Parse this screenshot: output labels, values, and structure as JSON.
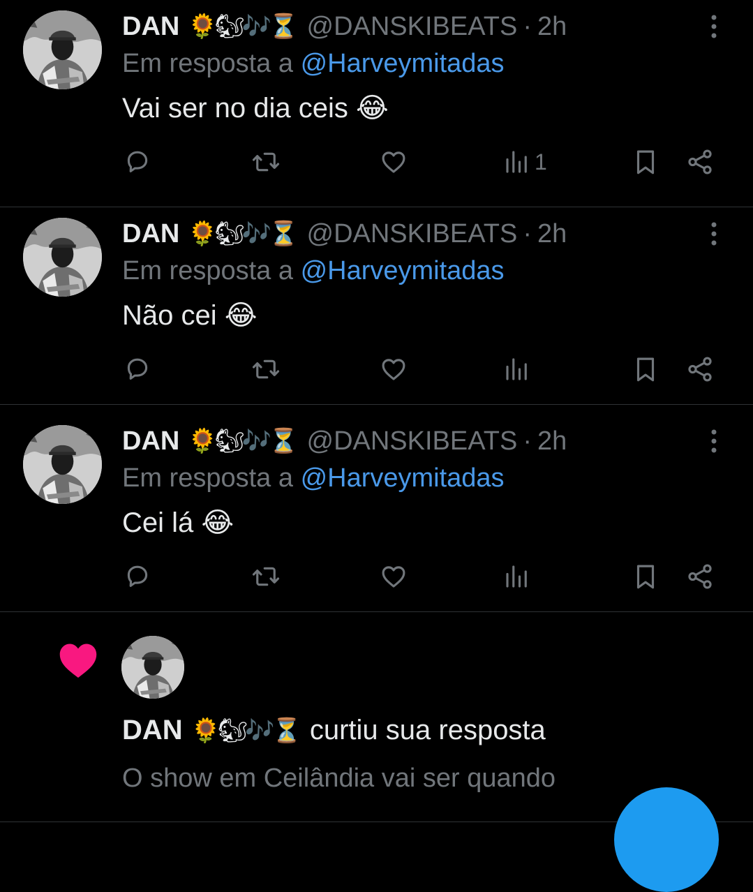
{
  "colors": {
    "background": "#000000",
    "text": "#e7e9ea",
    "secondary": "#71767b",
    "mention": "#4a99e9",
    "divider": "#2f3336",
    "like_heart": "#f91880",
    "fab": "#1d9bf0"
  },
  "tweets": [
    {
      "display_name": "DAN",
      "name_emojis": "🌻🐿🎶⏳",
      "handle": "@DANSKIBEATS",
      "separator": "·",
      "time": "2h",
      "reply_prefix": "Em resposta a",
      "reply_to": "@Harveymitadas",
      "text": "Vai ser no dia ceis 😂",
      "views": "1",
      "icons": [
        "reply-icon",
        "retweet-icon",
        "like-icon",
        "views-icon",
        "bookmark-icon",
        "share-icon",
        "more-icon"
      ]
    },
    {
      "display_name": "DAN",
      "name_emojis": "🌻🐿🎶⏳",
      "handle": "@DANSKIBEATS",
      "separator": "·",
      "time": "2h",
      "reply_prefix": "Em resposta a",
      "reply_to": "@Harveymitadas",
      "text": "Não cei 😂",
      "views": "",
      "icons": [
        "reply-icon",
        "retweet-icon",
        "like-icon",
        "views-icon",
        "bookmark-icon",
        "share-icon",
        "more-icon"
      ]
    },
    {
      "display_name": "DAN",
      "name_emojis": "🌻🐿🎶⏳",
      "handle": "@DANSKIBEATS",
      "separator": "·",
      "time": "2h",
      "reply_prefix": "Em resposta a",
      "reply_to": "@Harveymitadas",
      "text": "Cei lá 😂",
      "views": "",
      "icons": [
        "reply-icon",
        "retweet-icon",
        "like-icon",
        "views-icon",
        "bookmark-icon",
        "share-icon",
        "more-icon"
      ]
    }
  ],
  "notification": {
    "icon": "heart-icon",
    "display_name": "DAN",
    "name_emojis": "🌻🐿🎶⏳",
    "action": "curtiu sua resposta",
    "quoted_text": "O show em Ceilândia vai ser quando"
  }
}
